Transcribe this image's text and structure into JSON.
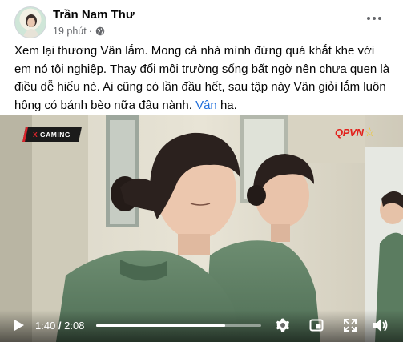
{
  "post": {
    "author": "Trần Nam Thư",
    "time": "19 phút",
    "separator": "·",
    "text_before": "Xem lại thương Vân lắm. Mong cả nhà mình đừng quá khắt khe với em nó tội nghiệp. Thay đổi môi trường sống bất ngờ nên chưa quen là điều dễ hiểu nè. Ai cũng có lần đầu hết,  sau tập này Vân giỏi lắm luôn hông có bánh bèo nữa đâu nành. ",
    "mention": "Vân",
    "text_after": " ha."
  },
  "video": {
    "logo_left": "GAMING",
    "logo_left_mark": "X",
    "logo_right": "QPVN",
    "current_time": "1:40",
    "time_separator": " / ",
    "duration": "2:08",
    "progress_fraction": 0.781,
    "buffered_fraction": 0.78
  },
  "icons": {
    "privacy": "globe-icon",
    "menu": "more-horizontal-icon",
    "play": "play-icon",
    "settings": "gear-icon",
    "pip": "picture-in-picture-icon",
    "fullscreen": "fullscreen-icon",
    "volume": "volume-icon"
  },
  "colors": {
    "link": "#216fdb",
    "secondary_text": "#65676b",
    "brand_red": "#e2211c"
  }
}
